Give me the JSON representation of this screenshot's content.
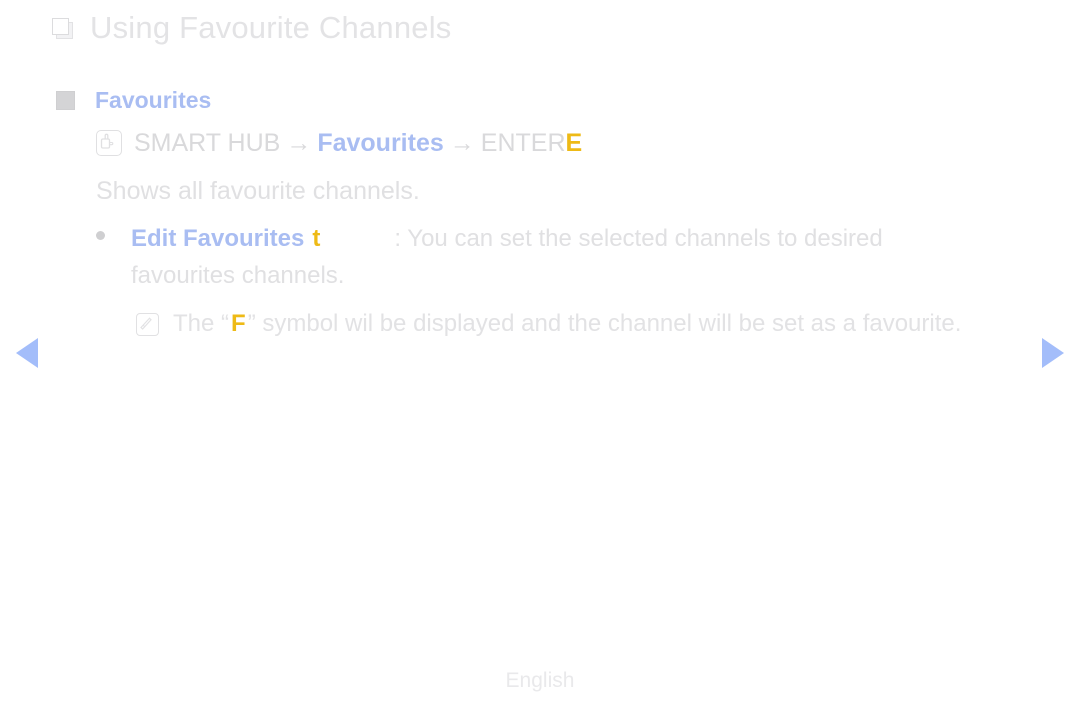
{
  "page": {
    "title": "Using Favourite Channels",
    "title_bullet_icon": "hollow-square-icon",
    "footer_language": "English"
  },
  "section": {
    "bullet_icon": "filled-square-icon",
    "heading": "Favourites",
    "path": {
      "icon": "hand-touch-icon",
      "root": "SMART HUB",
      "arrow": "→",
      "target": "Favourites",
      "action": "ENTER",
      "action_key": "E"
    },
    "description": "Shows all favourite channels."
  },
  "bullet_item": {
    "bullet_icon": "dot-bullet-icon",
    "label": "Edit Favourites",
    "key": "t",
    "description_line1": ": You can set the selected channels to desired",
    "description_line2": "favourites channels."
  },
  "note": {
    "icon": "note-pencil-icon",
    "text_before": "The “",
    "symbol": "F",
    "text_after": "” symbol wil be displayed and the channel will be set as a favourite."
  },
  "navigation": {
    "prev_label": "prev-page-arrow",
    "next_label": "next-page-arrow"
  },
  "colors": {
    "accent_blue": "#a9bdf2",
    "accent_amber": "#eeba16",
    "body_text": "#e0e0e2",
    "nav_arrow": "#a3bdfa"
  }
}
